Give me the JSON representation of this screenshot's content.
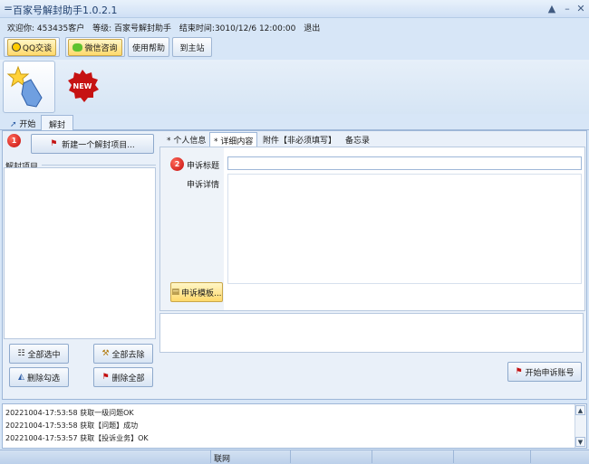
{
  "window": {
    "title": "百家号解封助手1.0.2.1",
    "controls": [
      "▲",
      "–",
      "✕"
    ]
  },
  "info": {
    "welcome": "欢迎你: 453435客户",
    "level": "等级: 百家号解封助手",
    "end_time": "结束时间:3010/12/6 12:00:00",
    "logout": "退出"
  },
  "toolbar": {
    "qq": "QQ交谈",
    "wechat": "微信咨询",
    "help": "使用帮助",
    "home": "到主站"
  },
  "tabs": {
    "start": "开始",
    "unlock": "解封"
  },
  "left": {
    "step_badge": "1",
    "new_project": "新建一个解封项目...",
    "project_label": "解封项目",
    "select_all": "全部选中",
    "remove_all": "全部去除",
    "delete_checked": "删除勾选",
    "delete_all": "删除全部"
  },
  "right": {
    "tabs": [
      "* 个人信息",
      "* 详细内容",
      "附件【非必须填写】",
      "备忘录"
    ],
    "step_badge": "2",
    "appeal_title_label": "申诉标题",
    "appeal_detail_label": "申诉详情",
    "template_button": "申诉模板...",
    "start_button": "开始申诉账号"
  },
  "log": {
    "lines": [
      "20221004-17:53:58 获取一级问题OK",
      "20221004-17:53:58 获取【问题】成功",
      "20221004-17:53:57 获取【投诉业务】OK"
    ]
  },
  "status": {
    "text": "联网"
  },
  "colors": {
    "accent": "#1f3f6e",
    "badge_red": "#c40c0c",
    "highlight_yellow": "#ffd96b"
  }
}
